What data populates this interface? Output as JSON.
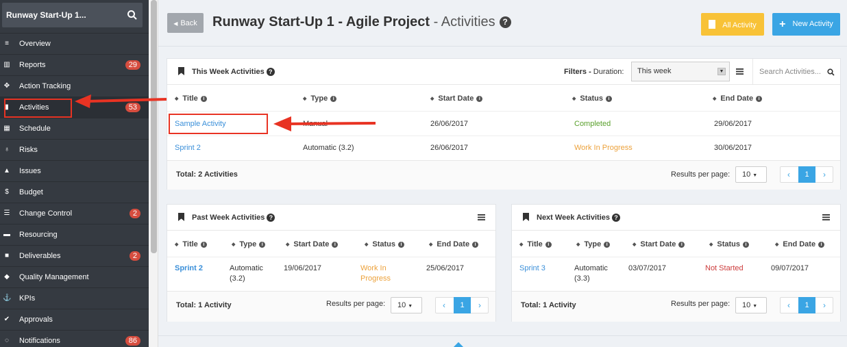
{
  "sidebar": {
    "search_title": "Runway Start-Up 1...",
    "items": [
      {
        "label": "Overview",
        "icon": "list-icon"
      },
      {
        "label": "Reports",
        "icon": "bar-chart-icon",
        "badge": "29"
      },
      {
        "label": "Action Tracking",
        "icon": "crosshair-icon"
      },
      {
        "label": "Activities",
        "icon": "bookmark-icon",
        "badge": "53"
      },
      {
        "label": "Schedule",
        "icon": "calendar-icon"
      },
      {
        "label": "Risks",
        "icon": "lightbulb-icon"
      },
      {
        "label": "Issues",
        "icon": "warning-icon"
      },
      {
        "label": "Budget",
        "icon": "dollar-icon"
      },
      {
        "label": "Change Control",
        "icon": "sliders-icon",
        "badge": "2"
      },
      {
        "label": "Resourcing",
        "icon": "folder-icon"
      },
      {
        "label": "Deliverables",
        "icon": "truck-icon",
        "badge": "2"
      },
      {
        "label": "Quality Management",
        "icon": "tag-icon"
      },
      {
        "label": "KPIs",
        "icon": "anchor-icon"
      },
      {
        "label": "Approvals",
        "icon": "thumbs-up-icon"
      },
      {
        "label": "Notifications",
        "icon": "bell-icon",
        "badge": "86"
      }
    ]
  },
  "header": {
    "back_label": "Back",
    "title_bold": "Runway Start-Up 1 - Agile Project",
    "title_sub": " - Activities",
    "all_activity_label": "All Activity",
    "new_activity_label": "New Activity"
  },
  "this_week": {
    "title": "This Week Activities",
    "filters_label": "Filters -",
    "duration_label": " Duration:",
    "duration_value": "This week",
    "search_placeholder": "Search Activities...",
    "columns": [
      "Title",
      "Type",
      "Start Date",
      "Status",
      "End Date"
    ],
    "rows": [
      {
        "title": "Sample Activity",
        "type": "Manual",
        "start": "26/06/2017",
        "status": "Completed",
        "end": "29/06/2017"
      },
      {
        "title": "Sprint 2",
        "type": "Automatic (3.2)",
        "start": "26/06/2017",
        "status": "Work In Progress",
        "end": "30/06/2017"
      }
    ],
    "total": "Total: 2 Activities",
    "rpp_label": "Results per page:",
    "rpp_value": "10",
    "page": "1"
  },
  "past_week": {
    "title": "Past Week Activities",
    "columns": [
      "Title",
      "Type",
      "Start Date",
      "Status",
      "End Date"
    ],
    "row": {
      "title": "Sprint 2",
      "type1": "Automatic",
      "type2": "(3.2)",
      "start": "19/06/2017",
      "status1": "Work In",
      "status2": "Progress",
      "end": "25/06/2017"
    },
    "total": "Total: 1 Activity",
    "rpp_label": "Results per page:",
    "rpp_value": "10",
    "page": "1"
  },
  "next_week": {
    "title": "Next Week Activities",
    "columns": [
      "Title",
      "Type",
      "Start Date",
      "Status",
      "End Date"
    ],
    "row": {
      "title": "Sprint 3",
      "type1": "Automatic",
      "type2": "(3.3)",
      "start": "03/07/2017",
      "status": "Not Started",
      "end": "09/07/2017"
    },
    "total": "Total: 1 Activity",
    "rpp_label": "Results per page:",
    "rpp_value": "10",
    "page": "1"
  },
  "colors": {
    "accent": "#3aa5e4",
    "warning": "#f8c237",
    "badge": "#d64d3f",
    "annotation": "#e83323"
  }
}
